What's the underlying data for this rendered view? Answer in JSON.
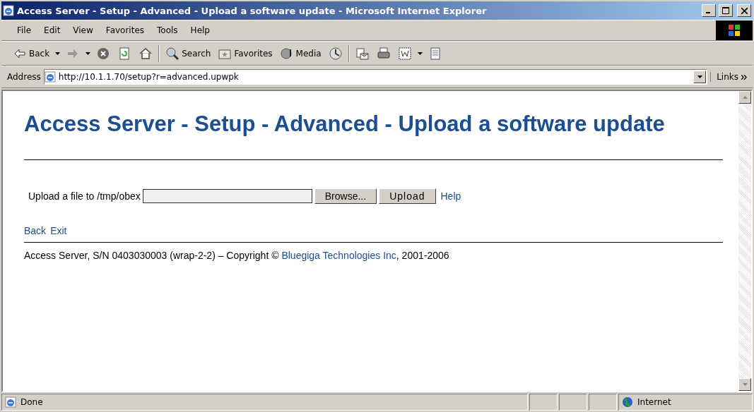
{
  "window": {
    "title": "Access Server - Setup - Advanced - Upload a software update - Microsoft Internet Explorer"
  },
  "menu": [
    "File",
    "Edit",
    "View",
    "Favorites",
    "Tools",
    "Help"
  ],
  "toolbar": [
    {
      "kind": "back",
      "label": "Back"
    },
    {
      "kind": "forward"
    },
    {
      "kind": "stop"
    },
    {
      "kind": "refresh"
    },
    {
      "kind": "home"
    },
    {
      "kind": "sep"
    },
    {
      "kind": "search",
      "label": "Search"
    },
    {
      "kind": "favorites",
      "label": "Favorites"
    },
    {
      "kind": "media",
      "label": "Media"
    },
    {
      "kind": "history"
    },
    {
      "kind": "sep"
    },
    {
      "kind": "mail"
    },
    {
      "kind": "print"
    },
    {
      "kind": "edit"
    },
    {
      "kind": "discuss"
    }
  ],
  "address": {
    "label": "Address",
    "value": "http://10.1.1.70/setup?r=advanced.upwpk",
    "links": "Links"
  },
  "page": {
    "heading": "Access Server - Setup - Advanced - Upload a software update",
    "upload_label": "Upload a file to /tmp/obex",
    "browse": "Browse...",
    "upload": "Upload",
    "help": "Help",
    "nav_links": [
      "Back",
      "Exit"
    ],
    "footer": {
      "before": "Access Server, S/N 0403030003 (wrap-2-2)  –  Copyright © ",
      "link": "Bluegiga Technologies Inc",
      "after": ", 2001-2006"
    }
  },
  "status_bar": {
    "text": "Done",
    "zone": "Internet"
  }
}
